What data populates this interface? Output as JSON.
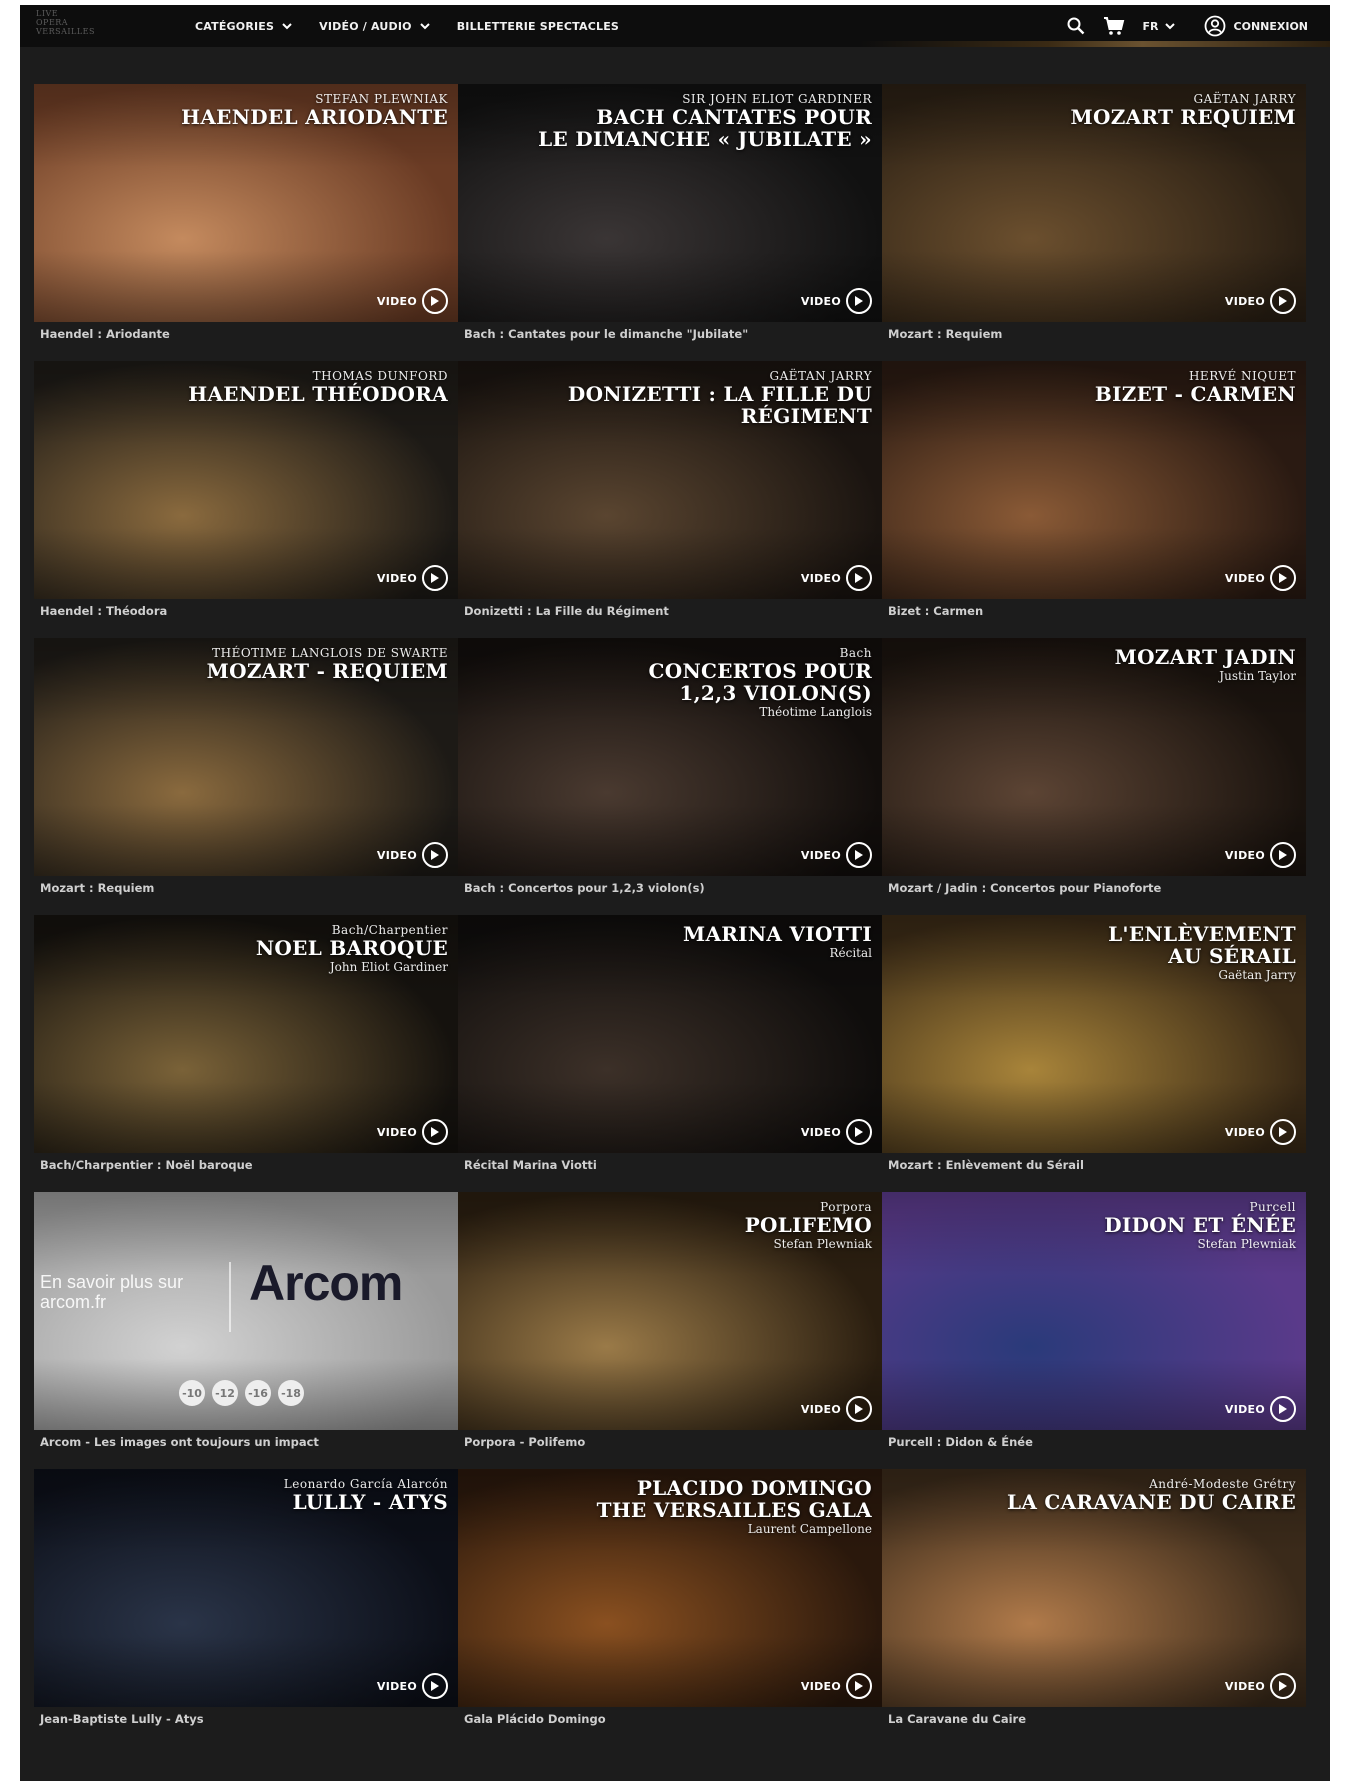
{
  "header": {
    "logo_lines": [
      "LIVE",
      "OPERA",
      "VERSAILLES"
    ],
    "nav": [
      {
        "label": "CATÉGORIES",
        "dropdown": true
      },
      {
        "label": "VIDÉO / AUDIO",
        "dropdown": true
      },
      {
        "label": "BILLETTERIE SPECTACLES",
        "dropdown": false
      }
    ],
    "language": "FR",
    "login_label": "CONNEXION"
  },
  "cards": [
    {
      "caption": "Haendel : Ariodante",
      "overlay_small": "STEFAN PLEWNIAK",
      "overlay_title": [
        "HAENDEL ARIODANTE"
      ],
      "overlay_sub": "",
      "badge": "VIDEO",
      "bg": "#6a3b24",
      "bg2": "#c48a5e"
    },
    {
      "caption": "Bach : Cantates pour le dimanche \"Jubilate\"",
      "overlay_small": "SIR JOHN ELIOT GARDINER",
      "overlay_title": [
        "BACH CANTATES POUR",
        "LE DIMANCHE « JUBILATE »"
      ],
      "overlay_sub": "",
      "badge": "VIDEO",
      "bg": "#111111",
      "bg2": "#3a3535"
    },
    {
      "caption": "Mozart : Requiem",
      "overlay_small": "GAËTAN JARRY",
      "overlay_title": [
        "MOZART REQUIEM"
      ],
      "overlay_sub": "",
      "badge": "VIDEO",
      "bg": "#2b2014",
      "bg2": "#6b4f2e"
    },
    {
      "caption": "Haendel : Théodora",
      "overlay_small": "THOMAS DUNFORD",
      "overlay_title": [
        "HAENDEL THÉODORA"
      ],
      "overlay_sub": "",
      "badge": "VIDEO",
      "bg": "#1d1a16",
      "bg2": "#8a6a3e"
    },
    {
      "caption": "Donizetti : La Fille du Régiment",
      "overlay_small": "GAËTAN JARRY",
      "overlay_title": [
        "DONIZETTI : LA FILLE DU RÉGIMENT"
      ],
      "overlay_sub": "",
      "badge": "VIDEO",
      "bg": "#1a1410",
      "bg2": "#5a4530"
    },
    {
      "caption": "Bizet : Carmen",
      "overlay_small": "HERVÉ NIQUET",
      "overlay_title": [
        "BIZET - CARMEN"
      ],
      "overlay_sub": "",
      "badge": "VIDEO",
      "bg": "#2a1a12",
      "bg2": "#8a5a36"
    },
    {
      "caption": "Mozart : Requiem",
      "overlay_small": "THÉOTIME LANGLOIS DE SWARTE",
      "overlay_title": [
        "MOZART - REQUIEM"
      ],
      "overlay_sub": "",
      "badge": "VIDEO",
      "bg": "#1d1a16",
      "bg2": "#8a6a3e"
    },
    {
      "caption": "Bach : Concertos pour 1,2,3 violon(s)",
      "overlay_small": "Bach",
      "overlay_title": [
        "CONCERTOS POUR",
        "1,2,3 VIOLON(S)"
      ],
      "overlay_sub": "Théotime Langlois",
      "badge": "VIDEO",
      "bg": "#120e0c",
      "bg2": "#4a3a30"
    },
    {
      "caption": "Mozart / Jadin : Concertos pour Pianoforte",
      "overlay_small": "",
      "overlay_title": [
        "MOZART JADIN"
      ],
      "overlay_sub": "Justin Taylor",
      "badge": "VIDEO",
      "bg": "#1a130e",
      "bg2": "#5c4434"
    },
    {
      "caption": "Bach/Charpentier : Noël baroque",
      "overlay_small": "Bach/Charpentier",
      "overlay_title": [
        "NOEL BAROQUE"
      ],
      "overlay_sub": "John Eliot Gardiner",
      "badge": "VIDEO",
      "bg": "#15120e",
      "bg2": "#7a6238"
    },
    {
      "caption": "Récital Marina Viotti",
      "overlay_small": "",
      "overlay_title": [
        "MARINA VIOTTI"
      ],
      "overlay_sub": "Récital",
      "badge": "VIDEO",
      "bg": "#0f0d0c",
      "bg2": "#3c3028"
    },
    {
      "caption": "Mozart : Enlèvement du Sérail",
      "overlay_small": "",
      "overlay_title": [
        "L'ENLÈVEMENT",
        "AU SÉRAIL"
      ],
      "overlay_sub": "Gaëtan Jarry",
      "badge": "VIDEO",
      "bg": "#3a2a16",
      "bg2": "#a8843a"
    },
    {
      "caption": "Arcom - Les images ont toujours un impact",
      "overlay_small": "",
      "overlay_title": [],
      "overlay_sub": "",
      "badge": "",
      "bg": "#9a9a9a",
      "bg2": "#d2d2d2",
      "arcom": {
        "text": [
          "En savoir plus sur",
          "arcom.fr"
        ],
        "logo": "Arcom",
        "ratings": [
          "-10",
          "-12",
          "-16",
          "-18"
        ]
      }
    },
    {
      "caption": "Porpora - Polifemo",
      "overlay_small": "Porpora",
      "overlay_title": [
        "POLIFEMO"
      ],
      "overlay_sub": "Stefan Plewniak",
      "badge": "VIDEO",
      "bg": "#2a1e10",
      "bg2": "#9a7a48"
    },
    {
      "caption": "Purcell : Didon & Énée",
      "overlay_small": "Purcell",
      "overlay_title": [
        "DIDON ET ÉNÉE"
      ],
      "overlay_sub": "Stefan Plewniak",
      "badge": "VIDEO",
      "bg": "#5a3a8a",
      "bg2": "#2a3a7a"
    },
    {
      "caption": "Jean-Baptiste Lully - Atys",
      "overlay_small": "Leonardo García Alarcón",
      "overlay_title": [
        "LULLY - ATYS"
      ],
      "overlay_sub": "",
      "badge": "VIDEO",
      "bg": "#0c0f18",
      "bg2": "#2a3448"
    },
    {
      "caption": "Gala Plácido Domingo",
      "overlay_small": "",
      "overlay_title": [
        "PLACIDO DOMINGO",
        "THE VERSAILLES GALA"
      ],
      "overlay_sub": "Laurent Campellone",
      "badge": "VIDEO",
      "bg": "#2a180c",
      "bg2": "#8a5020"
    },
    {
      "caption": "La Caravane du Caire",
      "overlay_small": "André-Modeste Grétry",
      "overlay_title": [
        "LA CARAVANE DU CAIRE"
      ],
      "overlay_sub": "",
      "badge": "VIDEO",
      "bg": "#3a2a1a",
      "bg2": "#b07a4a"
    }
  ]
}
